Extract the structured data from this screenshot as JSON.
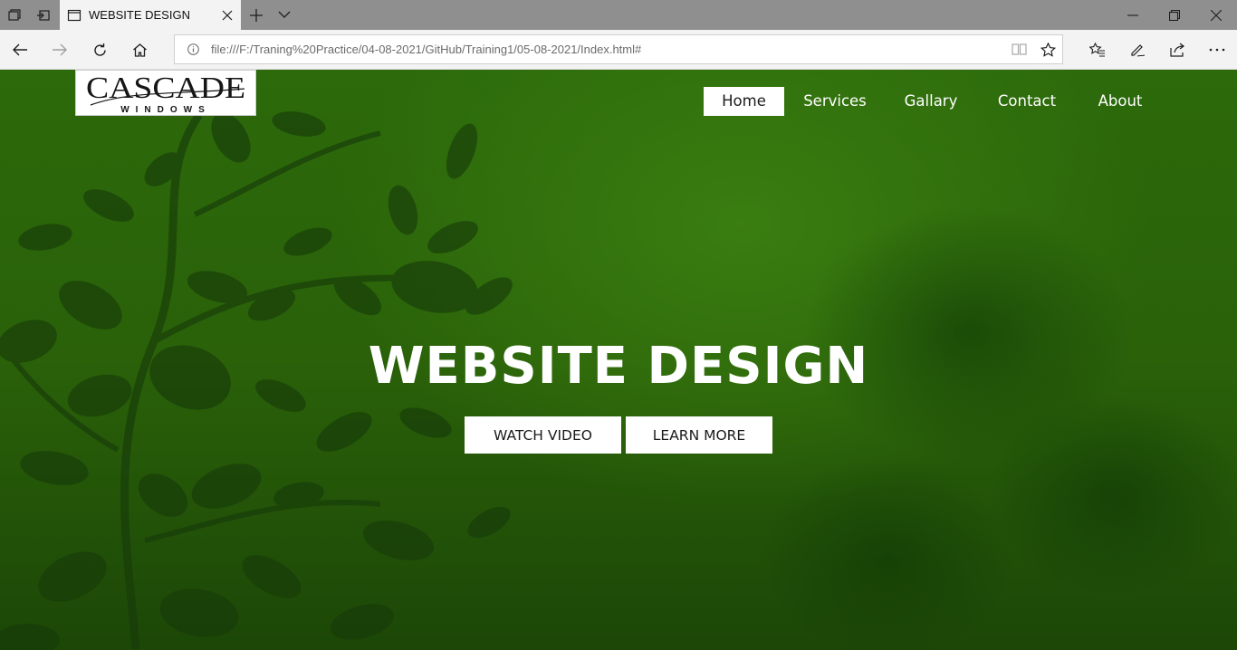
{
  "browser": {
    "tab": {
      "title": "WEBSITE DESIGN"
    },
    "address": {
      "url": "file:///F:/Traning%20Practice/04-08-2021/GitHub/Training1/05-08-2021/Index.html#"
    },
    "icons": [
      "tab-actions-icon",
      "set-aside-tabs-icon",
      "page-icon",
      "close-icon",
      "new-tab-icon",
      "chevron-down-icon",
      "minimize-icon",
      "restore-icon",
      "window-close-icon",
      "back-icon",
      "forward-icon",
      "refresh-icon",
      "home-icon",
      "info-icon",
      "reading-view-icon",
      "star-icon",
      "favorites-icon",
      "pen-icon",
      "share-icon",
      "more-icon"
    ]
  },
  "site": {
    "logo": {
      "brand": "CASCADE",
      "tagline": "W I N D O W S"
    },
    "nav": [
      {
        "label": "Home",
        "active": true
      },
      {
        "label": "Services"
      },
      {
        "label": "Gallary"
      },
      {
        "label": "Contact"
      },
      {
        "label": "About"
      }
    ],
    "hero": {
      "title": "WEBSITE DESIGN",
      "watch_label": "WATCH VIDEO",
      "learn_label": "LEARN MORE"
    },
    "colors": {
      "background": "#2a6109",
      "accent": "#ffffff",
      "leaf": "#1b3d0c"
    }
  }
}
